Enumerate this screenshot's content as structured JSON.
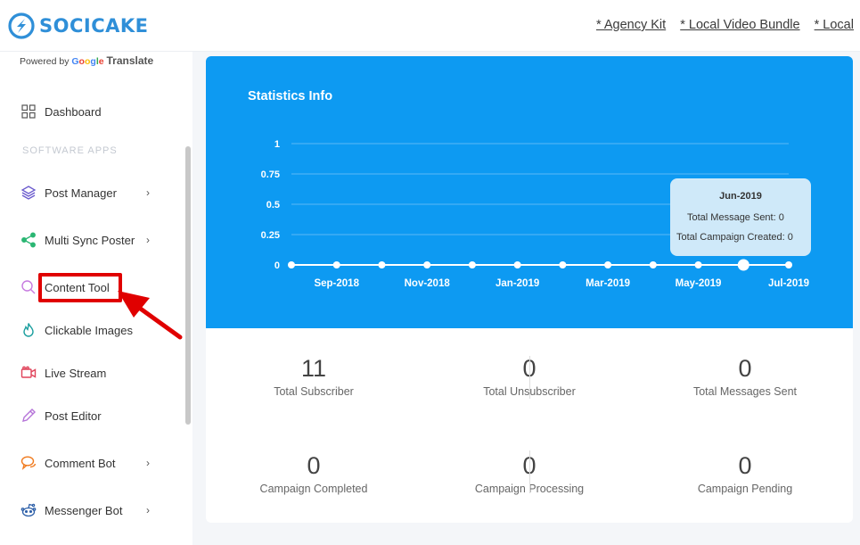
{
  "brand": {
    "name": "SOCICAKE",
    "color": "#2f8fd8"
  },
  "top_links": [
    "* Agency Kit",
    "* Local Video Bundle",
    "* Local"
  ],
  "sidebar": {
    "powered_prefix": "Powered by",
    "google": [
      "G",
      "o",
      "o",
      "g",
      "l",
      "e"
    ],
    "translate": "Translate",
    "section_label": "SOFTWARE APPS",
    "items": [
      {
        "label": "Dashboard",
        "icon": "grid-icon",
        "chevron": false
      },
      {
        "label": "Post Manager",
        "icon": "layers-icon",
        "chevron": true
      },
      {
        "label": "Multi Sync Poster",
        "icon": "share-icon",
        "chevron": true
      },
      {
        "label": "Content Tool",
        "icon": "search-icon",
        "chevron": false,
        "highlighted": true
      },
      {
        "label": "Clickable Images",
        "icon": "fire-icon",
        "chevron": false
      },
      {
        "label": "Live Stream",
        "icon": "video-icon",
        "chevron": false
      },
      {
        "label": "Post Editor",
        "icon": "pencil-icon",
        "chevron": false
      },
      {
        "label": "Comment Bot",
        "icon": "chat-icon",
        "chevron": true
      },
      {
        "label": "Messenger Bot",
        "icon": "reddit-icon",
        "chevron": true
      }
    ],
    "chevron": "›"
  },
  "statistics": {
    "title": "Statistics Info",
    "tooltip": {
      "title": "Jun-2019",
      "line1": "Total Message Sent: 0",
      "line2": "Total Campaign Created: 0"
    }
  },
  "chart_data": {
    "type": "line",
    "x": [
      "Aug-2018",
      "Sep-2018",
      "Oct-2018",
      "Nov-2018",
      "Dec-2018",
      "Jan-2019",
      "Feb-2019",
      "Mar-2019",
      "Apr-2019",
      "May-2019",
      "Jun-2019",
      "Jul-2019"
    ],
    "x_tick_labels": [
      "Sep-2018",
      "Nov-2018",
      "Jan-2019",
      "Mar-2019",
      "May-2019",
      "Jul-2019"
    ],
    "y_ticks": [
      "0",
      "0.25",
      "0.5",
      "0.75",
      "1"
    ],
    "ylim": [
      0,
      1
    ],
    "series": [
      {
        "values": [
          0,
          0,
          0,
          0,
          0,
          0,
          0,
          0,
          0,
          0,
          0,
          0
        ]
      }
    ],
    "active_index": 10,
    "grid": true,
    "colors": {
      "background": "#0d9af2",
      "line": "#ffffff",
      "grid": "#5ab8f5"
    }
  },
  "stats": [
    {
      "value": "11",
      "label": "Total Subscriber"
    },
    {
      "value": "0",
      "label": "Total Unsubscriber"
    },
    {
      "value": "0",
      "label": "Total Messages Sent"
    },
    {
      "value": "0",
      "label": "Campaign Completed"
    },
    {
      "value": "0",
      "label": "Campaign Processing"
    },
    {
      "value": "0",
      "label": "Campaign Pending"
    }
  ]
}
